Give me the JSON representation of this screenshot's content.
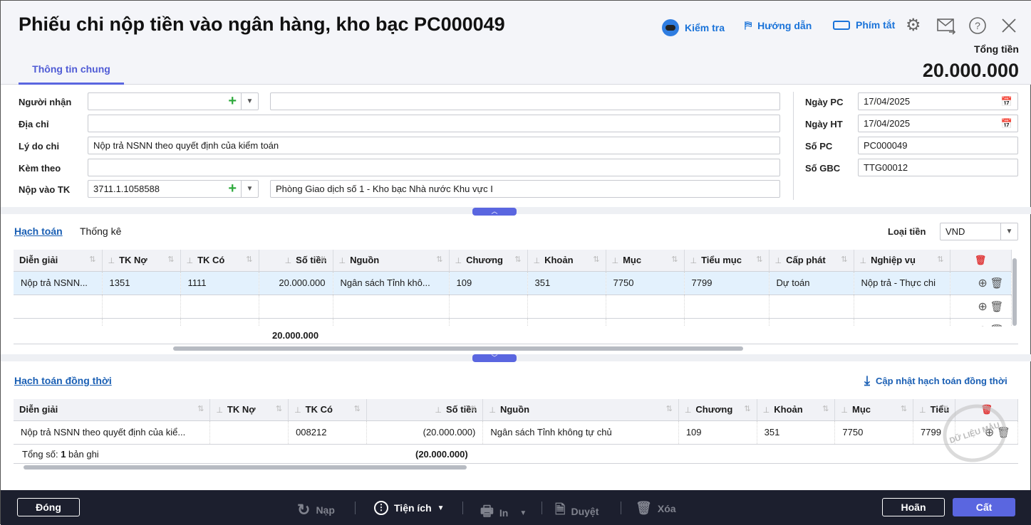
{
  "header": {
    "title": "Phiếu chi nộp tiền vào ngân hàng, kho bạc PC000049",
    "tools": [
      {
        "label": "Kiểm tra",
        "icon": "robot-icon"
      },
      {
        "label": "Hướng dẫn",
        "icon": "signpost-icon"
      },
      {
        "label": "Phím tắt",
        "icon": "keyboard-icon"
      }
    ],
    "icons": [
      "gear-icon",
      "mail-forward-icon",
      "help-icon",
      "close-icon"
    ],
    "total_label": "Tổng tiền",
    "total_value": "20.000.000",
    "tab": "Thông tin chung"
  },
  "form": {
    "nguoi_nhan": {
      "label": "Người nhận",
      "value": "",
      "name_value": ""
    },
    "dia_chi": {
      "label": "Địa chỉ",
      "value": ""
    },
    "ly_do_chi": {
      "label": "Lý do chi",
      "value": "Nộp trả NSNN theo quyết định của kiểm toán"
    },
    "kem_theo": {
      "label": "Kèm theo",
      "value": ""
    },
    "nop_vao_tk": {
      "label": "Nộp vào TK",
      "value": "3711.1.1058588",
      "bank": "Phòng Giao dịch số 1 - Kho bạc Nhà nước Khu vực I"
    },
    "ngay_pc": {
      "label": "Ngày PC",
      "value": "17/04/2025"
    },
    "ngay_ht": {
      "label": "Ngày HT",
      "value": "17/04/2025"
    },
    "so_pc": {
      "label": "Số PC",
      "value": "PC000049"
    },
    "so_gbc": {
      "label": "Số GBC",
      "value": "TTG00012"
    }
  },
  "accounting": {
    "tabs": [
      "Hạch toán",
      "Thống kê"
    ],
    "currency_label": "Loại tiền",
    "currency": "VND",
    "columns": [
      "Diễn giải",
      "TK Nợ",
      "TK Có",
      "Số tiền",
      "Nguồn",
      "Chương",
      "Khoản",
      "Mục",
      "Tiểu mục",
      "Cấp phát",
      "Nghiệp vụ"
    ],
    "rows": [
      [
        "Nộp trả NSNN...",
        "1351",
        "1111",
        "20.000.000",
        "Ngân sách Tỉnh khô...",
        "109",
        "351",
        "7750",
        "7799",
        "Dự toán",
        "Nộp trả - Thực chi"
      ]
    ],
    "total": "20.000.000"
  },
  "concurrent": {
    "title": "Hạch toán đồng thời",
    "update_label": "Cập nhật hạch toán đồng thời",
    "columns": [
      "Diễn giải",
      "TK Nợ",
      "TK Có",
      "Số tiền",
      "Nguồn",
      "Chương",
      "Khoản",
      "Mục",
      "Tiểu"
    ],
    "rows": [
      [
        "Nộp trả NSNN theo quyết định của kiể...",
        "",
        "008212",
        "(20.000.000)",
        "Ngân sách Tỉnh không tự chủ",
        "109",
        "351",
        "7750",
        "7799"
      ]
    ],
    "total_prefix": "Tổng số: ",
    "total_count": "1",
    "total_suffix": " bản ghi",
    "total": "(20.000.000)"
  },
  "watermark": "DỮ LIỆU MẪU",
  "footer": {
    "close": "Đóng",
    "reload": "Nạp",
    "utilities": "Tiện ích",
    "print": "In",
    "approve": "Duyệt",
    "delete": "Xóa",
    "cancel": "Hoãn",
    "save": "Cất"
  },
  "colors": {
    "accent": "#5a66e0",
    "link": "#1a73d9",
    "footer_bg": "#1c1f2e",
    "selected_row": "#e3f1fd"
  }
}
